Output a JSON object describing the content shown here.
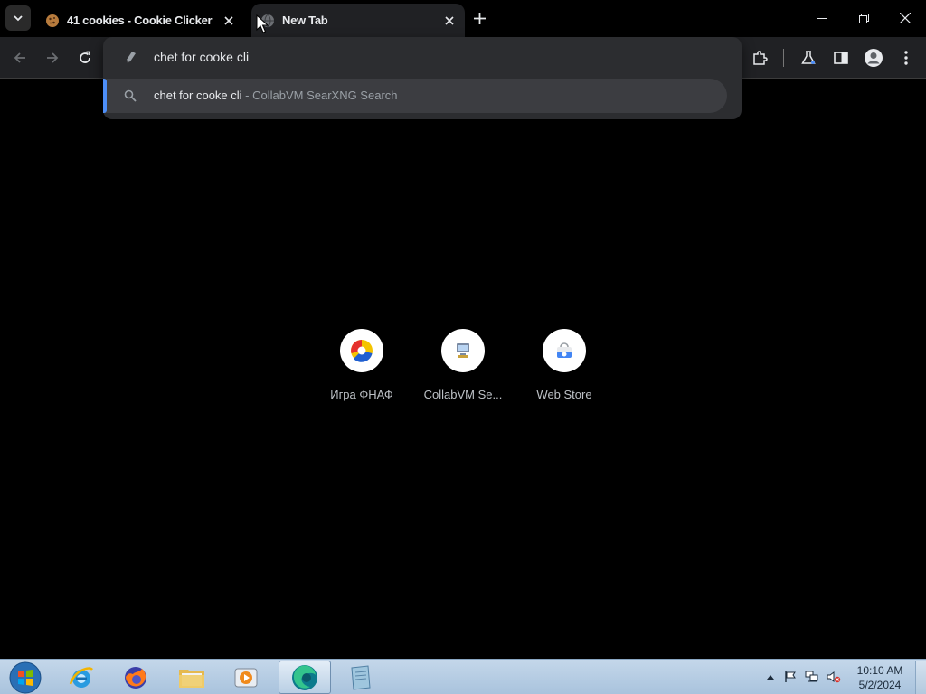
{
  "browser": {
    "tabs": [
      {
        "title": "41 cookies - Cookie Clicker",
        "active": false
      },
      {
        "title": "New Tab",
        "active": true
      }
    ],
    "omnibox": {
      "value": "chet for cooke cli",
      "suggestion": {
        "query": "chet for cooke cli",
        "source": " - CollabVM SearXNG Search"
      }
    },
    "shortcuts": [
      {
        "label": "Игра ФНАФ",
        "icon": "fnaf-game-icon"
      },
      {
        "label": "CollabVM Se...",
        "icon": "collabvm-icon"
      },
      {
        "label": "Web Store",
        "icon": "web-store-icon"
      }
    ]
  },
  "taskbar": {
    "apps": [
      {
        "name": "start-button"
      },
      {
        "name": "internet-explorer"
      },
      {
        "name": "firefox"
      },
      {
        "name": "file-explorer"
      },
      {
        "name": "media-player"
      },
      {
        "name": "browser-active"
      },
      {
        "name": "notepad-app"
      }
    ],
    "clock": {
      "time": "10:10 AM",
      "date": "5/2/2024"
    }
  },
  "colors": {
    "accent": "#4d8ef7",
    "background": "#000000",
    "toolbar": "#202124"
  }
}
